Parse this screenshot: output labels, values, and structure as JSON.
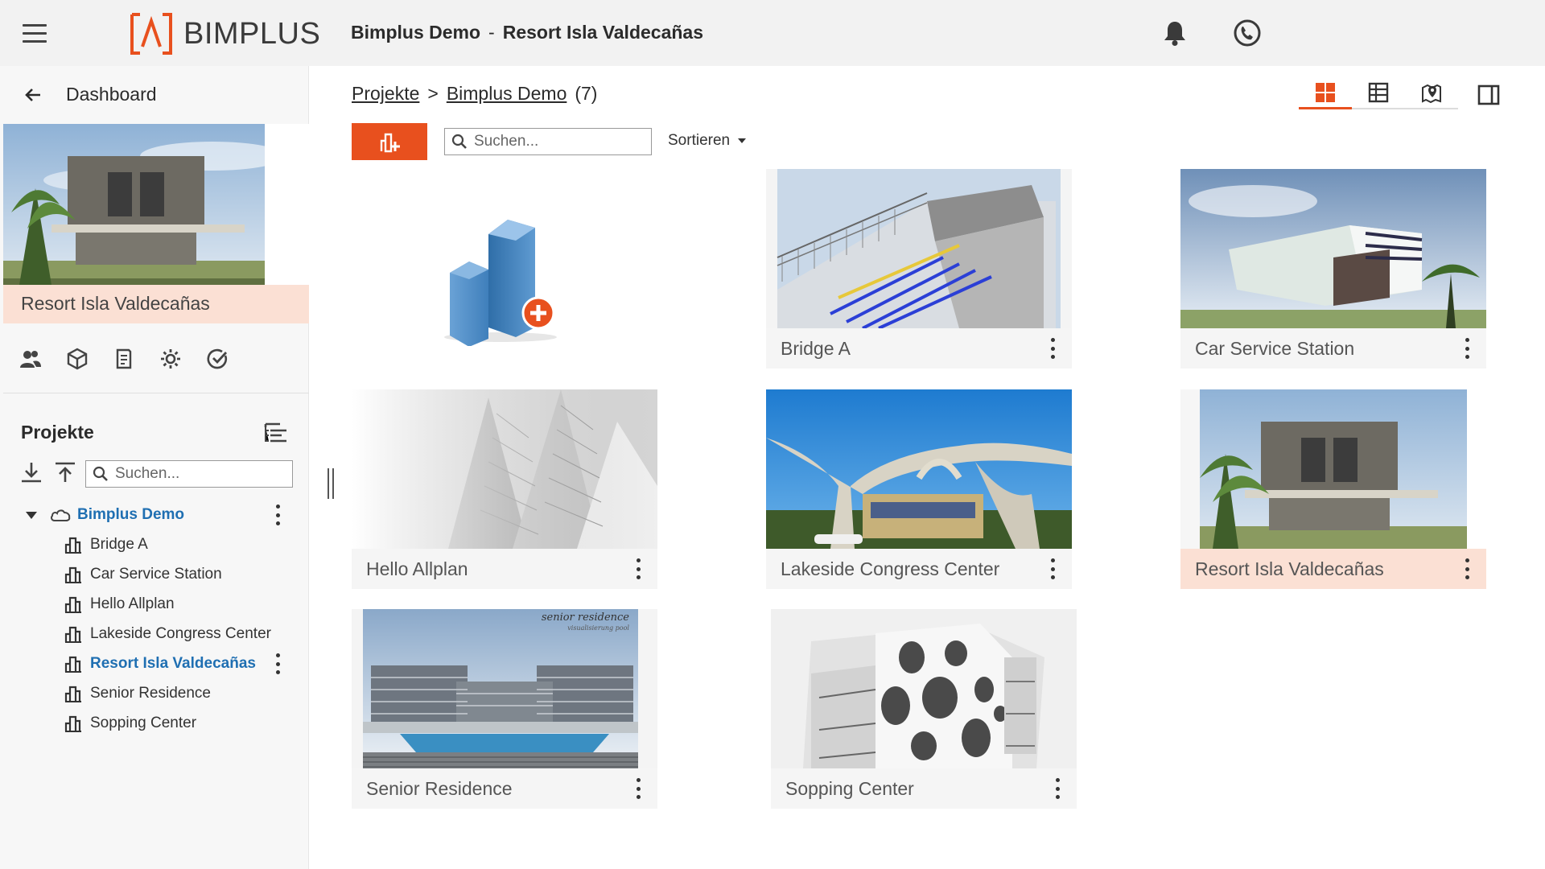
{
  "header": {
    "logo_text": "BIMPLUS",
    "project_title": "Bimplus Demo",
    "separator": "-",
    "subtitle": "Resort Isla Valdecañas"
  },
  "sidebar": {
    "back_label": "Dashboard",
    "current_project": "Resort Isla Valdecañas",
    "projects_heading": "Projekte",
    "search_placeholder": "Suchen...",
    "tree": {
      "root": "Bimplus Demo",
      "items": [
        {
          "label": "Bridge A",
          "active": false
        },
        {
          "label": "Car Service Station",
          "active": false
        },
        {
          "label": "Hello Allplan",
          "active": false
        },
        {
          "label": "Lakeside Congress Center",
          "active": false
        },
        {
          "label": "Resort Isla Valdecañas",
          "active": true
        },
        {
          "label": "Senior Residence",
          "active": false
        },
        {
          "label": "Sopping Center",
          "active": false
        }
      ]
    }
  },
  "main": {
    "breadcrumb": {
      "root": "Projekte",
      "separator": ">",
      "current": "Bimplus Demo",
      "count": "(7)"
    },
    "search_placeholder": "Suchen...",
    "sort_label": "Sortieren",
    "cards": [
      {
        "title": "Bridge A"
      },
      {
        "title": "Car Service Station"
      },
      {
        "title": "Hello Allplan"
      },
      {
        "title": "Lakeside Congress Center"
      },
      {
        "title": "Resort Isla Valdecañas"
      },
      {
        "title": "Senior Residence"
      },
      {
        "title": "Sopping Center"
      }
    ],
    "senior_thumb_text": "senior residence",
    "senior_thumb_subtext": "visualisierung pool"
  },
  "colors": {
    "accent": "#e8501e",
    "link_blue": "#1f6fb2",
    "highlight": "#fbe0d4"
  }
}
